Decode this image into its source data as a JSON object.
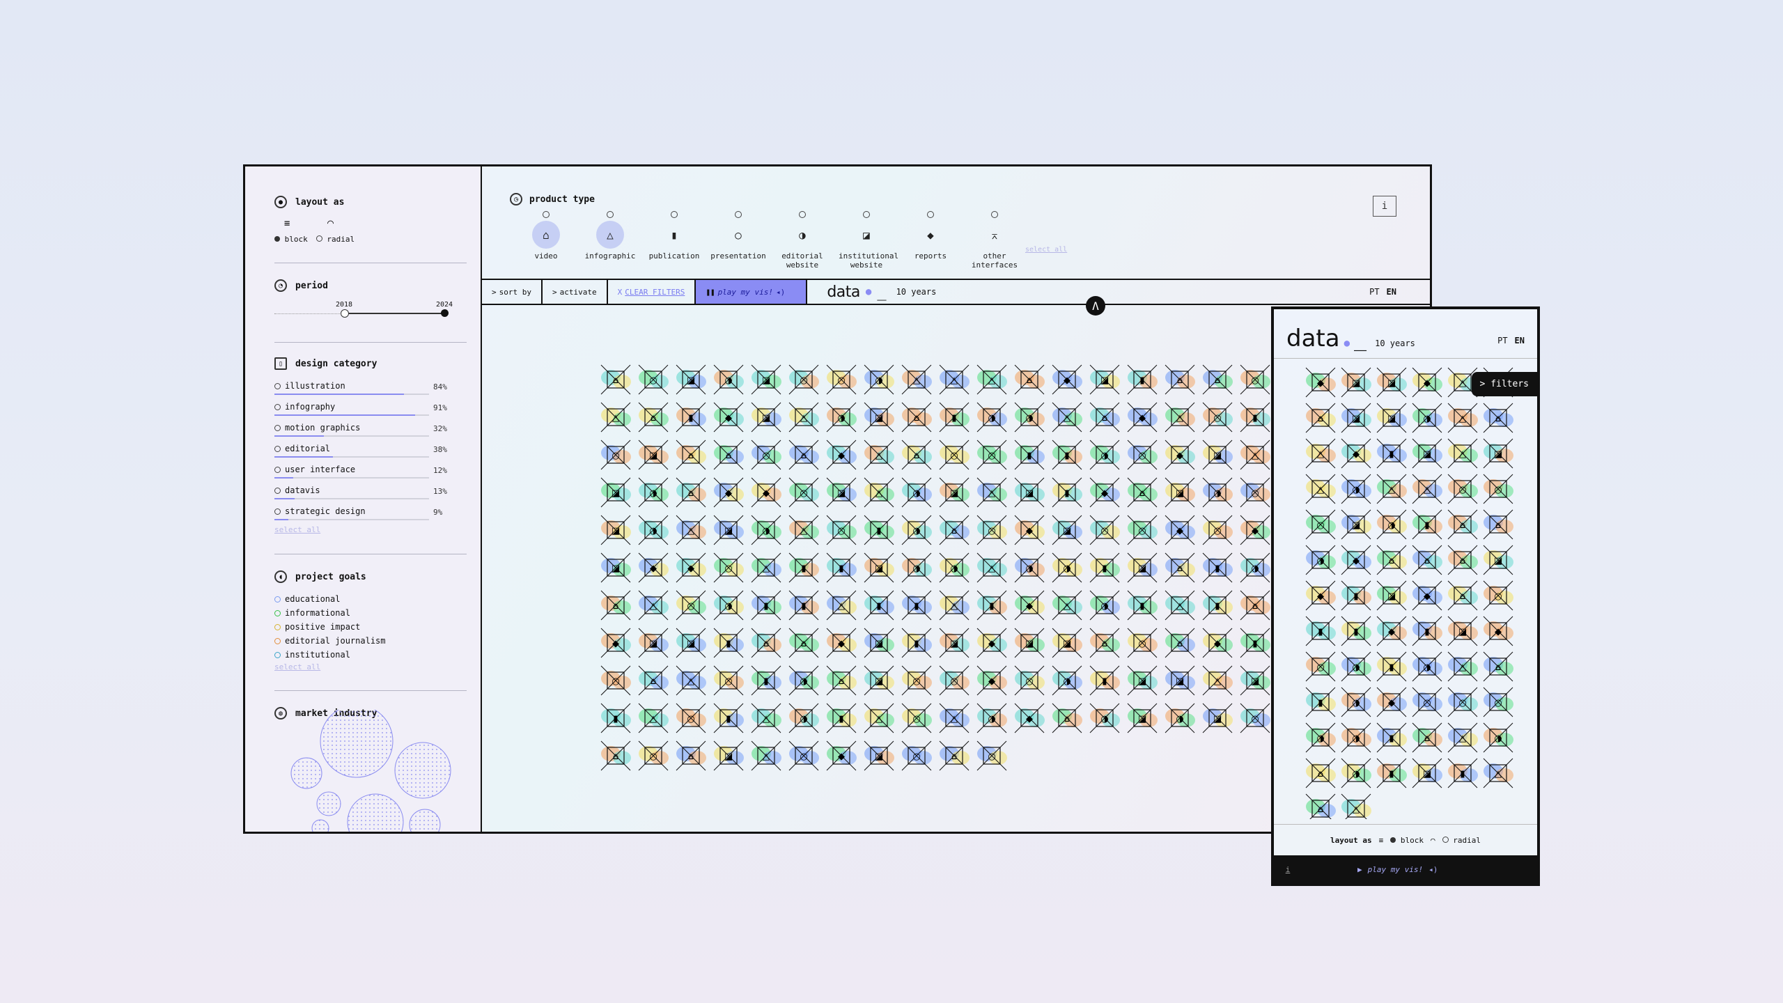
{
  "sidebar": {
    "layout": {
      "title": "layout as",
      "options": [
        "block",
        "radial"
      ]
    },
    "period": {
      "title": "period",
      "start": "2018",
      "end": "2024"
    },
    "design_category": {
      "title": "design category",
      "items": [
        {
          "label": "illustration",
          "pct": "84%",
          "value": 0.84
        },
        {
          "label": "infography",
          "pct": "91%",
          "value": 0.91
        },
        {
          "label": "motion graphics",
          "pct": "32%",
          "value": 0.32
        },
        {
          "label": "editorial",
          "pct": "38%",
          "value": 0.38
        },
        {
          "label": "user interface",
          "pct": "12%",
          "value": 0.12
        },
        {
          "label": "datavis",
          "pct": "13%",
          "value": 0.13
        },
        {
          "label": "strategic design",
          "pct": "9%",
          "value": 0.09
        }
      ],
      "select_all": "select all"
    },
    "project_goals": {
      "title": "project goals",
      "items": [
        {
          "label": "educational",
          "color": "#7a9cf0"
        },
        {
          "label": "informational",
          "color": "#39c24a"
        },
        {
          "label": "positive impact",
          "color": "#d6b431"
        },
        {
          "label": "editorial journalism",
          "color": "#e28e3c"
        },
        {
          "label": "institutional",
          "color": "#3aa4c8"
        }
      ],
      "select_all": "select all"
    },
    "market_industry": {
      "title": "market industry"
    }
  },
  "product_type": {
    "title": "product type",
    "items": [
      {
        "label": "video",
        "selected": true,
        "icon": "video-icon"
      },
      {
        "label": "infographic",
        "selected": true,
        "icon": "infographic-icon"
      },
      {
        "label": "publication",
        "selected": false,
        "icon": "publication-icon"
      },
      {
        "label": "presentation",
        "selected": false,
        "icon": "presentation-icon"
      },
      {
        "label": "editorial website",
        "selected": false,
        "icon": "editorial-website-icon"
      },
      {
        "label": "institutional website",
        "selected": false,
        "icon": "institutional-website-icon"
      },
      {
        "label": "reports",
        "selected": false,
        "icon": "reports-icon"
      },
      {
        "label": "other interfaces",
        "selected": false,
        "icon": "other-interfaces-icon"
      }
    ],
    "select_all": "select all"
  },
  "toolbar": {
    "sort_by": "sort by",
    "activate": "activate",
    "clear_filters": "CLEAR FILTERS",
    "play": "play my vis!",
    "brand": "data",
    "years": "10 years",
    "lang_pt": "PT",
    "lang_en": "EN",
    "info": "i"
  },
  "mobile": {
    "brand": "data",
    "years": "10 years",
    "lang_pt": "PT",
    "lang_en": "EN",
    "filters": "> filters",
    "layout_label": "layout as",
    "layout_options": [
      "block",
      "radial"
    ],
    "info": "i",
    "play": "play my vis!"
  },
  "colors": {
    "accent": "#8a8cf4",
    "blue": "#7aa2f7",
    "green": "#5fe08a",
    "yellow": "#f2e06a",
    "orange": "#f2a86a",
    "teal": "#69d9d0"
  }
}
